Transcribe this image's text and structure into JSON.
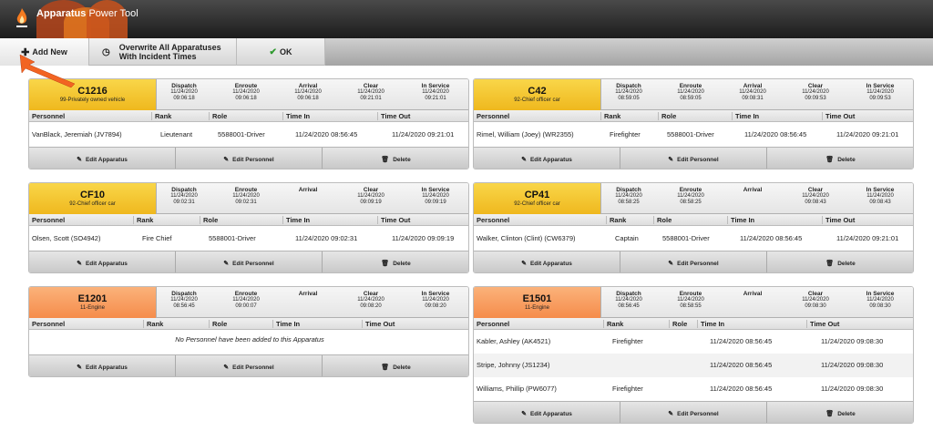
{
  "app": {
    "title_bold": "Apparatus",
    "title_rest": " Power Tool"
  },
  "toolbar": {
    "add_new": "Add New",
    "overwrite_line1": "Overwrite All Apparatuses",
    "overwrite_line2": "With Incident Times",
    "ok": "OK"
  },
  "stat_labels": [
    "Dispatch",
    "Enroute",
    "Arrival",
    "Clear",
    "In Service"
  ],
  "columns": {
    "personnel": "Personnel",
    "rank": "Rank",
    "role": "Role",
    "time_in": "Time In",
    "time_out": "Time Out"
  },
  "footer": {
    "edit_apparatus": "Edit Apparatus",
    "edit_personnel": "Edit Personnel",
    "delete": "Delete"
  },
  "no_personnel": "No Personnel have been added to this Apparatus",
  "colors": {
    "yellow_header": "#f2c12a",
    "orange_header": "#f7975a",
    "ok_check": "#2f9a2f",
    "arrow": "#f26422"
  },
  "cards": [
    {
      "name": "C1216",
      "type": "99-Privately owned vehicle",
      "color": "yellow",
      "stats": [
        {
          "date": "11/24/2020",
          "time": "09:06:18"
        },
        {
          "date": "11/24/2020",
          "time": "09:06:18"
        },
        {
          "date": "11/24/2020",
          "time": "09:06:18"
        },
        {
          "date": "11/24/2020",
          "time": "09:21:01"
        },
        {
          "date": "11/24/2020",
          "time": "09:21:01"
        }
      ],
      "personnel": [
        {
          "name": "VanBlack, Jeremiah (JV7894)",
          "rank": "Lieutenant",
          "role": "5588001-Driver",
          "time_in": "11/24/2020 08:56:45",
          "time_out": "11/24/2020 09:21:01"
        }
      ]
    },
    {
      "name": "C42",
      "type": "92-Chief officer car",
      "color": "yellow",
      "stats": [
        {
          "date": "11/24/2020",
          "time": "08:59:05"
        },
        {
          "date": "11/24/2020",
          "time": "08:59:05"
        },
        {
          "date": "11/24/2020",
          "time": "09:08:31"
        },
        {
          "date": "11/24/2020",
          "time": "09:09:53"
        },
        {
          "date": "11/24/2020",
          "time": "09:09:53"
        }
      ],
      "personnel": [
        {
          "name": "Rimel, William (Joey) (WR2355)",
          "rank": "Firefighter",
          "role": "5588001-Driver",
          "time_in": "11/24/2020 08:56:45",
          "time_out": "11/24/2020 09:21:01"
        }
      ]
    },
    {
      "name": "CF10",
      "type": "92-Chief officer car",
      "color": "yellow",
      "stats": [
        {
          "date": "11/24/2020",
          "time": "09:02:31"
        },
        {
          "date": "11/24/2020",
          "time": "09:02:31"
        },
        {
          "date": "",
          "time": ""
        },
        {
          "date": "11/24/2020",
          "time": "09:09:19"
        },
        {
          "date": "11/24/2020",
          "time": "09:09:19"
        }
      ],
      "personnel": [
        {
          "name": "Olsen, Scott (SO4942)",
          "rank": "Fire Chief",
          "role": "5588001-Driver",
          "time_in": "11/24/2020 09:02:31",
          "time_out": "11/24/2020 09:09:19"
        }
      ]
    },
    {
      "name": "CP41",
      "type": "92-Chief officer car",
      "color": "yellow",
      "stats": [
        {
          "date": "11/24/2020",
          "time": "08:58:25"
        },
        {
          "date": "11/24/2020",
          "time": "08:58:25"
        },
        {
          "date": "",
          "time": ""
        },
        {
          "date": "11/24/2020",
          "time": "09:08:43"
        },
        {
          "date": "11/24/2020",
          "time": "09:08:43"
        }
      ],
      "personnel": [
        {
          "name": "Walker, Clinton (Clint) (CW6379)",
          "rank": "Captain",
          "role": "5588001-Driver",
          "time_in": "11/24/2020 08:56:45",
          "time_out": "11/24/2020 09:21:01"
        }
      ]
    },
    {
      "name": "E1201",
      "type": "11-Engine",
      "color": "orange",
      "stats": [
        {
          "date": "11/24/2020",
          "time": "08:56:45"
        },
        {
          "date": "11/24/2020",
          "time": "09:00:07"
        },
        {
          "date": "",
          "time": ""
        },
        {
          "date": "11/24/2020",
          "time": "09:08:20"
        },
        {
          "date": "11/24/2020",
          "time": "09:08:20"
        }
      ],
      "personnel": []
    },
    {
      "name": "E1501",
      "type": "11-Engine",
      "color": "orange",
      "stats": [
        {
          "date": "11/24/2020",
          "time": "08:56:45"
        },
        {
          "date": "11/24/2020",
          "time": "08:58:55"
        },
        {
          "date": "",
          "time": ""
        },
        {
          "date": "11/24/2020",
          "time": "09:08:30"
        },
        {
          "date": "11/24/2020",
          "time": "09:08:30"
        }
      ],
      "personnel": [
        {
          "name": "Kabler, Ashley (AK4521)",
          "rank": "Firefighter",
          "role": "",
          "time_in": "11/24/2020 08:56:45",
          "time_out": "11/24/2020 09:08:30"
        },
        {
          "name": "Stripe, Johnny (JS1234)",
          "rank": "",
          "role": "",
          "time_in": "11/24/2020 08:56:45",
          "time_out": "11/24/2020 09:08:30"
        },
        {
          "name": "Williams, Phillip (PW6077)",
          "rank": "Firefighter",
          "role": "",
          "time_in": "11/24/2020 08:56:45",
          "time_out": "11/24/2020 09:08:30"
        }
      ]
    }
  ]
}
